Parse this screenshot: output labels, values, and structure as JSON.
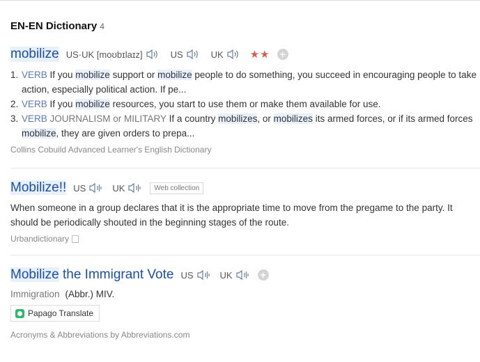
{
  "section": {
    "title": "EN-EN Dictionary",
    "count": "4"
  },
  "entry1": {
    "word": "mobilize",
    "pron_label": "US·UK",
    "pron_ipa": "[moʊbɪlaɪz]",
    "us_label": "US",
    "uk_label": "UK",
    "stars": "★★",
    "defs": [
      {
        "num": "1.",
        "pos": "VERB",
        "t1": " If you ",
        "w1": "mobilize",
        "t2": " support or ",
        "w2": "mobilize",
        "t3": " people to do something, you succeed in encouraging people to take action, especially political action. If pe..."
      },
      {
        "num": "2.",
        "pos": "VERB",
        "t1": " If you ",
        "w1": "mobilize",
        "t2": " resources, you start to use them or make them available for use."
      },
      {
        "num": "3.",
        "pos": "VERB",
        "domain": " JOURNALISM or MILITARY",
        "t1": "  If a country ",
        "w1": "mobilizes",
        "t2": ", or ",
        "w2": "mobilizes",
        "t3": " its armed forces, or if its armed forces ",
        "w3": "mobilize",
        "t4": ", they are given orders to prepa..."
      }
    ],
    "source": "Collins Cobuild Advanced Learner's English Dictionary"
  },
  "entry2": {
    "word": "Mobilize!!",
    "us_label": "US",
    "uk_label": "UK",
    "tag": "Web collection",
    "definition": "When someone in a group declares that it is the appropriate time to move from the pregame to the party. It should be periodically shouted in the beginning stages of the route.",
    "source": "Urbandictionary"
  },
  "entry3": {
    "word_hl": "Mobilize",
    "word_rest": " the Immigrant Vote",
    "us_label": "US",
    "uk_label": "UK",
    "category": "Immigration",
    "abbr": "(Abbr.) MIV.",
    "translate_label": "Papago Translate",
    "source": "Acronyms & Abbreviations by Abbreviations.com"
  },
  "icons": {
    "speaker": "speaker-icon",
    "add": "plus-circle-icon",
    "copy": "copy-icon",
    "papago": "papago-logo-icon"
  },
  "colors": {
    "headword": "#1a4fa8",
    "highlight": "#e8f0fb",
    "stars": "#e05a4b",
    "pos": "#5a7bb5"
  }
}
